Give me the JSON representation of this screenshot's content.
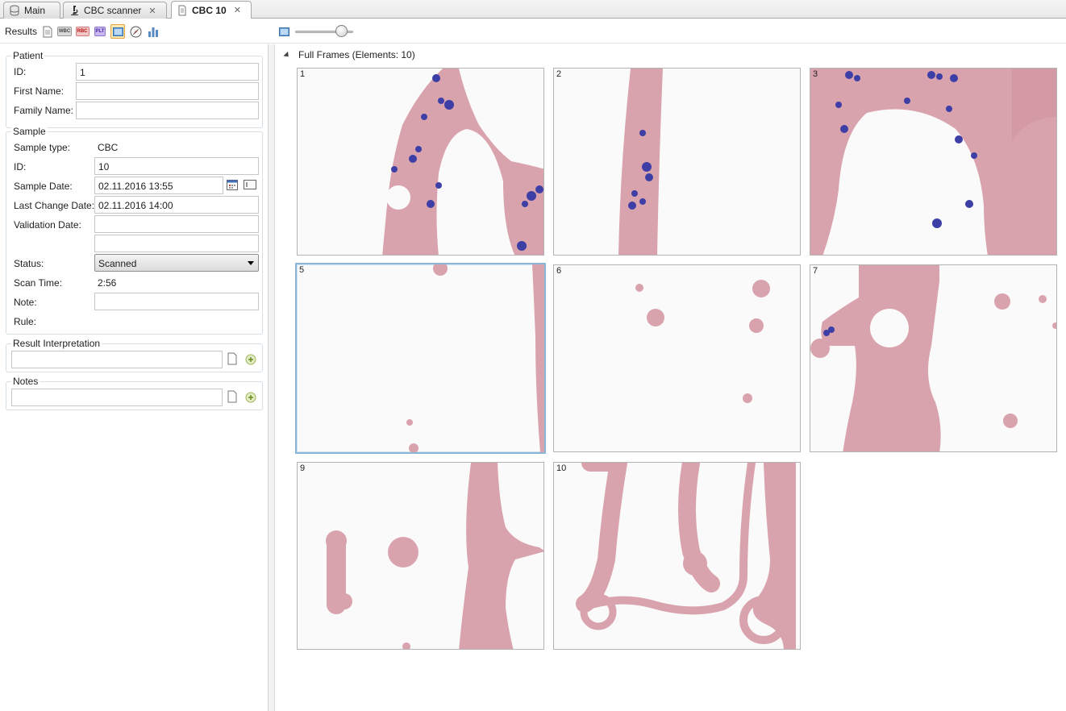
{
  "tabs": [
    {
      "label": "Main",
      "icon": "database-icon",
      "closable": false
    },
    {
      "label": "CBC scanner",
      "icon": "microscope-icon",
      "closable": true
    },
    {
      "label": "CBC 10",
      "icon": "document-icon",
      "closable": true,
      "active": true
    }
  ],
  "toolbar": {
    "label": "Results",
    "badges": {
      "wbc": "WBC",
      "rbc": "RBC",
      "plt": "PLT"
    },
    "zoom_level": 0.8
  },
  "patient": {
    "title": "Patient",
    "id_label": "ID:",
    "id_value": "1",
    "first_name_label": "First Name:",
    "first_name_value": "",
    "family_name_label": "Family Name:",
    "family_name_value": ""
  },
  "sample": {
    "title": "Sample",
    "type_label": "Sample type:",
    "type_value": "CBC",
    "id_label": "ID:",
    "id_value": "10",
    "date_label": "Sample Date:",
    "date_value": "02.11.2016 13:55",
    "last_change_label": "Last Change Date:",
    "last_change_value": "02.11.2016 14:00",
    "validation_label": "Validation Date:",
    "validation_value": "",
    "validation_value_2": "",
    "status_label": "Status:",
    "status_value": "Scanned",
    "scan_time_label": "Scan Time:",
    "scan_time_value": "2:56",
    "note_label": "Note:",
    "note_value": "",
    "rule_label": "Rule:"
  },
  "result_interpretation": {
    "title": "Result Interpretation",
    "value": ""
  },
  "notes": {
    "title": "Notes",
    "value": ""
  },
  "frames_section": {
    "header": "Full Frames (Elements: 10)",
    "frames": [
      {
        "number": "1",
        "content": "stained-smear-dense"
      },
      {
        "number": "2",
        "content": "stained-smear-vertical-band"
      },
      {
        "number": "3",
        "content": "stained-smear-arch"
      },
      {
        "number": "5",
        "content": "sparse-edge",
        "selected": true
      },
      {
        "number": "6",
        "content": "sparse-clusters"
      },
      {
        "number": "7",
        "content": "rbc-network"
      },
      {
        "number": "9",
        "content": "rbc-chains"
      },
      {
        "number": "10",
        "content": "rbc-loops"
      }
    ]
  },
  "colors": {
    "tissue": "#d9a3ad",
    "tissue_dark": "#c98593",
    "nucleus": "#3d3fa6",
    "background": "#fbfafb",
    "selection": "#8bb7d6"
  }
}
